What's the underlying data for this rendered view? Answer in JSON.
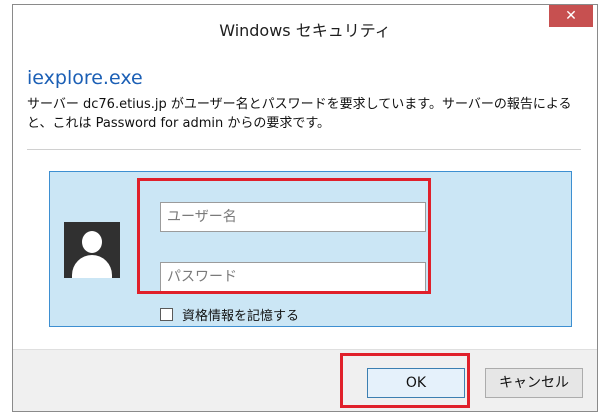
{
  "window": {
    "title": "Windows セキュリティ",
    "close_icon_text": "✕"
  },
  "app": {
    "name": "iexplore.exe",
    "message": "サーバー dc76.etius.jp がユーザー名とパスワードを要求しています。サーバーの報告によると、これは Password for admin  からの要求です。"
  },
  "credentials": {
    "username_placeholder": "ユーザー名",
    "password_placeholder": "パスワード",
    "remember_label": "資格情報を記憶する"
  },
  "buttons": {
    "ok": "OK",
    "cancel": "キャンセル"
  },
  "colors": {
    "accent": "#1b5fb5",
    "panel": "#cbe6f5",
    "highlight": "#e0202a",
    "close": "#c75050"
  },
  "icons": {
    "avatar": "user-silhouette-icon",
    "close": "close-icon"
  }
}
